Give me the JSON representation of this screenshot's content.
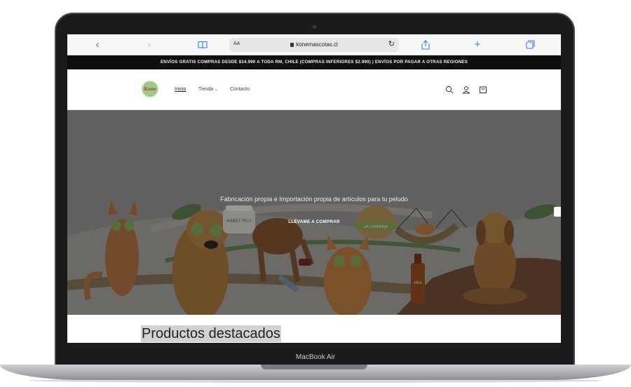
{
  "device": {
    "brand": "MacBook Air"
  },
  "browser": {
    "text_size_label": "AA",
    "url": "konemascotas.cl",
    "icons": [
      "chevron-left-icon",
      "chevron-right-icon",
      "book-icon",
      "reload-icon",
      "share-icon",
      "plus-icon",
      "tabs-icon"
    ]
  },
  "store": {
    "announcement": "ENVÍOS GRATIS COMPRAS DESDE $34.990 A TODA RM, CHILE (COMPRAS INFERIORES $2.990) | ENVÍOS POR PAGAR A OTRAS REGIONES",
    "logo_text": "Kone",
    "nav": [
      {
        "label": "Inicio",
        "active": true
      },
      {
        "label": "Tienda",
        "active": false
      },
      {
        "label": "Contacto",
        "active": false
      }
    ],
    "header_icons": [
      "search-icon",
      "account-icon",
      "cart-icon"
    ]
  },
  "hero": {
    "title": "Fabricación propia e Importación propia de artículos para tu peludo",
    "cta": "LLÉVAME A COMPRAR",
    "jar_label": "HABET PELY",
    "badge_label": "LA CORRERIA",
    "bottle_label": "ARIX"
  },
  "featured": {
    "title": "Productos destacados"
  },
  "colors": {
    "accent": "#2f7cf6",
    "announce_bg": "#0e0e0e",
    "hero_bg": "#8c8b89"
  }
}
